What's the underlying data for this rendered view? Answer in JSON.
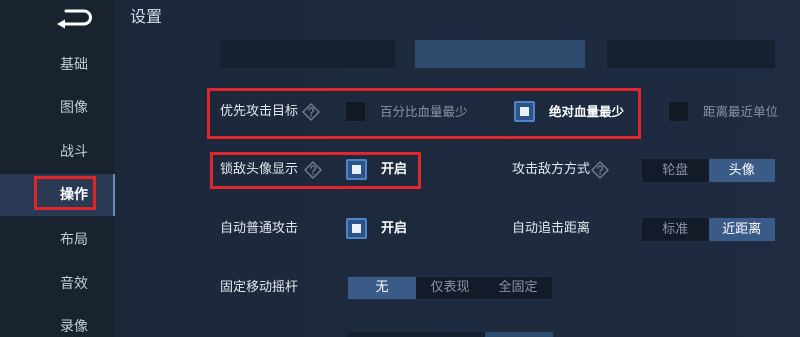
{
  "header": {
    "title": "设置",
    "back_icon": "back-icon"
  },
  "sidebar": {
    "items": [
      {
        "label": "基础",
        "selected": false
      },
      {
        "label": "图像",
        "selected": false
      },
      {
        "label": "战斗",
        "selected": false
      },
      {
        "label": "操作",
        "selected": true
      },
      {
        "label": "布局",
        "selected": false
      },
      {
        "label": "音效",
        "selected": false
      },
      {
        "label": "录像",
        "selected": false
      }
    ]
  },
  "settings": {
    "top_cutoff_segments": [
      {
        "selected": false
      },
      {
        "selected": true
      },
      {
        "selected": false
      }
    ],
    "attack_priority": {
      "label": "优先攻击目标",
      "help_icon": "help-icon",
      "options": [
        {
          "label": "百分比血量最少",
          "checked": false
        },
        {
          "label": "绝对血量最少",
          "checked": true
        },
        {
          "label": "距离最近单位",
          "checked": false
        }
      ]
    },
    "lock_target_avatar": {
      "label": "锁敌头像显示",
      "help_icon": "help-icon",
      "option": {
        "label": "开启",
        "checked": true
      }
    },
    "attack_enemy_mode": {
      "label": "攻击敌方方式",
      "help_icon": "help-icon",
      "segments": [
        {
          "label": "轮盘",
          "selected": false
        },
        {
          "label": "头像",
          "selected": true
        }
      ]
    },
    "auto_basic_attack": {
      "label": "自动普通攻击",
      "option": {
        "label": "开启",
        "checked": true
      }
    },
    "auto_chase_distance": {
      "label": "自动追击距离",
      "segments": [
        {
          "label": "标准",
          "selected": false
        },
        {
          "label": "近距离",
          "selected": true
        }
      ]
    },
    "fixed_joystick": {
      "label": "固定移动摇杆",
      "segments": [
        {
          "label": "无",
          "selected": true
        },
        {
          "label": "仅表现",
          "selected": false
        },
        {
          "label": "全固定",
          "selected": false
        }
      ]
    },
    "bottom_cutoff_segments": [
      {
        "selected": false
      },
      {
        "selected": true
      }
    ]
  },
  "colors": {
    "background": "#1c2739",
    "sidebar": "#19222f",
    "sidebar_selected": "#2a3a55",
    "accent": "#3a5b87",
    "checkbox": "#4f84c6",
    "control_dark": "#131b29",
    "text": "#e3e8ef",
    "text_muted": "#8893a6",
    "annotation": "#e0262b"
  }
}
